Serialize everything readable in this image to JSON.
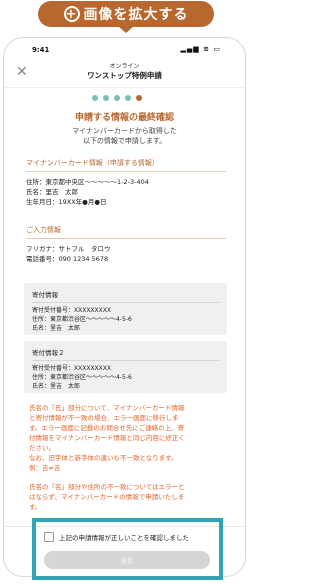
{
  "badge": {
    "icon": "plus-circle-icon",
    "label": "画像を拡大する"
  },
  "status_bar": {
    "time": "9:41",
    "icons": "▂▄▆ ≋ ▭"
  },
  "header": {
    "subtitle": "オンライン",
    "title": "ワンストップ特例申請",
    "close_icon": "close-icon"
  },
  "stepper": {
    "total": 5,
    "current": 5
  },
  "page": {
    "heading": "申請する情報の最終確認",
    "description": [
      "マイナンバーカードから取得した",
      "以下の情報で申請します。"
    ]
  },
  "mynumber_section": {
    "title": "マイナンバーカード情報（申請する情報）",
    "rows": [
      "住所：東京都中央区〜〜〜〜〜1-2-3-404",
      "氏名：里吉　太郎",
      "生年月日：19XX年●月●日"
    ]
  },
  "input_section": {
    "title": "ご入力情報",
    "rows": [
      "フリガナ：サトフル　タロウ",
      "電話番号：090 1234 5678"
    ]
  },
  "donation_boxes": [
    {
      "title": "寄付情報",
      "lines": [
        "寄付受付番号：XXXXXXXXX",
        "住所：東京都渋谷区〜〜〜〜〜4-5-6",
        "氏名：里吉　太郎"
      ]
    },
    {
      "title": "寄付情報２",
      "lines": [
        "寄付受付番号：XXXXXXXXX",
        "住所：東京都渋谷区〜〜〜〜〜4-5-6",
        "氏名：里吉　太郎"
      ]
    }
  ],
  "notice": {
    "para1": [
      "氏名の「氏」部分について、マイナンバーカード情報",
      "と寄付情報が不一致の場合、エラー画面に移行しま",
      "す。エラー画面に記載のお問合せ先にご連絡の上、寄",
      "付情報をマイナンバーカード情報と同じ内容に修正く",
      "ださい。",
      "なお、旧字体と新字体の違いも不一致となります。",
      "例：吉≠吉"
    ],
    "para2": [
      "氏名の「名」部分や住所の不一致についてはエラーと",
      "はならず、マイナンバーカードの情報で申請いたしま",
      "す。"
    ]
  },
  "confirm": {
    "label": "上記の申請情報が正しいことを確認しました",
    "checked": false
  },
  "submit": {
    "label": "送信"
  },
  "colors": {
    "brand": "#b8672e",
    "step": "#7fbdb8",
    "notice": "#e8622a",
    "highlight": "#2fa4b5"
  }
}
